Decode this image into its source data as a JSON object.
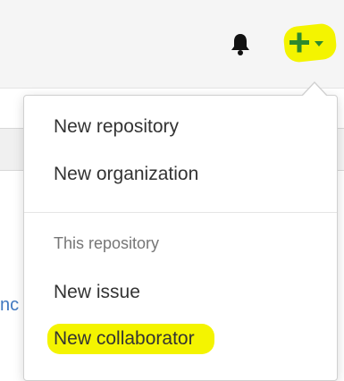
{
  "header": {
    "notifications_icon": "bell-icon",
    "create_icon": "plus-icon",
    "create_caret_icon": "caret-down-icon",
    "highlight_color": "#f4f400",
    "create_icon_color": "#2d8a2d"
  },
  "background": {
    "partial_text": "nc"
  },
  "dropdown": {
    "items": [
      {
        "label": "New repository"
      },
      {
        "label": "New organization"
      }
    ],
    "section_header": "This repository",
    "section_items": [
      {
        "label": "New issue"
      },
      {
        "label": "New collaborator",
        "highlighted": true
      }
    ]
  }
}
